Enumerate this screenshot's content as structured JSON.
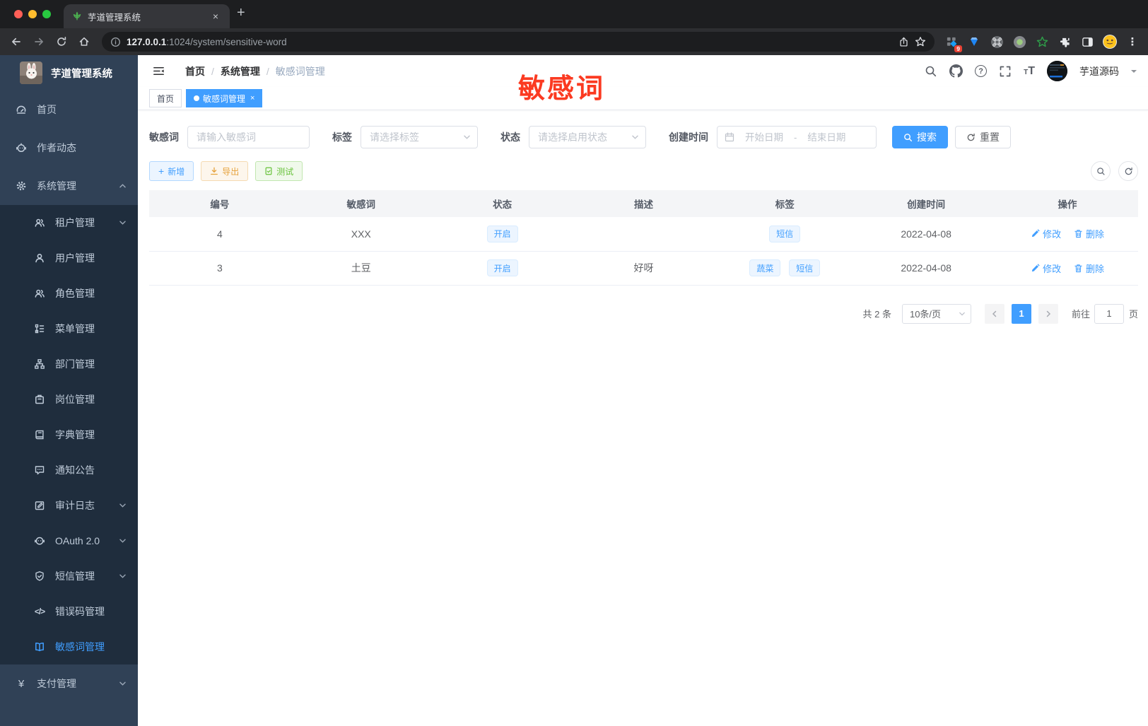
{
  "browser": {
    "tab_title": "芋道管理系统",
    "url_host": "127.0.0.1",
    "url_rest": ":1024/system/sensitive-word",
    "extension_badge": "9"
  },
  "icons": {
    "close": "×",
    "new_tab": "+",
    "overflow_menu": "⋮",
    "question": "?",
    "font_large": "T",
    "font_small": "T",
    "code": "</>",
    "yen": "¥",
    "plus": "+"
  },
  "sidebar": {
    "title": "芋道管理系统",
    "items": [
      {
        "label": "首页"
      },
      {
        "label": "作者动态"
      },
      {
        "label": "系统管理"
      },
      {
        "label": "租户管理"
      },
      {
        "label": "用户管理"
      },
      {
        "label": "角色管理"
      },
      {
        "label": "菜单管理"
      },
      {
        "label": "部门管理"
      },
      {
        "label": "岗位管理"
      },
      {
        "label": "字典管理"
      },
      {
        "label": "通知公告"
      },
      {
        "label": "审计日志"
      },
      {
        "label": "OAuth 2.0"
      },
      {
        "label": "短信管理"
      },
      {
        "label": "错误码管理"
      },
      {
        "label": "敏感词管理"
      },
      {
        "label": "支付管理"
      }
    ]
  },
  "header": {
    "breadcrumb_home": "首页",
    "breadcrumb_section": "系统管理",
    "breadcrumb_current": "敏感词管理",
    "separator": "/",
    "username": "芋道源码"
  },
  "annotation": {
    "text": "敏感词",
    "color": "#fb3a21"
  },
  "tags": {
    "home": "首页",
    "active": "敏感词管理",
    "close": "×"
  },
  "filters": {
    "keyword_label": "敏感词",
    "keyword_placeholder": "请输入敏感词",
    "tag_label": "标签",
    "tag_placeholder": "请选择标签",
    "status_label": "状态",
    "status_placeholder": "请选择启用状态",
    "date_label": "创建时间",
    "date_start": "开始日期",
    "date_separator": "-",
    "date_end": "结束日期",
    "search": "搜索",
    "reset": "重置"
  },
  "toolbar": {
    "add": "新增",
    "export": "导出",
    "test": "测试"
  },
  "table": {
    "columns": [
      "编号",
      "敏感词",
      "状态",
      "描述",
      "标签",
      "创建时间",
      "操作"
    ],
    "actions": {
      "edit": "修改",
      "remove": "删除"
    },
    "rows": [
      {
        "id": "4",
        "word": "XXX",
        "status": "开启",
        "description": "",
        "tags": [
          "短信"
        ],
        "created_at": "2022-04-08"
      },
      {
        "id": "3",
        "word": "土豆",
        "status": "开启",
        "description": "好呀",
        "tags": [
          "蔬菜",
          "短信"
        ],
        "created_at": "2022-04-08"
      }
    ]
  },
  "pagination": {
    "total": "共 2 条",
    "page_size": "10条/页",
    "page": "1",
    "goto_label": "前往",
    "goto_value": "1",
    "page_unit": "页"
  },
  "colors": {
    "primary": "#409eff",
    "warning_text": "#e6a23c",
    "success_text": "#67c23a",
    "annotation_red": "#fb3a21",
    "sidebar_bg": "#304156",
    "submenu_bg": "#1f2d3d",
    "chrome_bg": "#1d1e20"
  }
}
